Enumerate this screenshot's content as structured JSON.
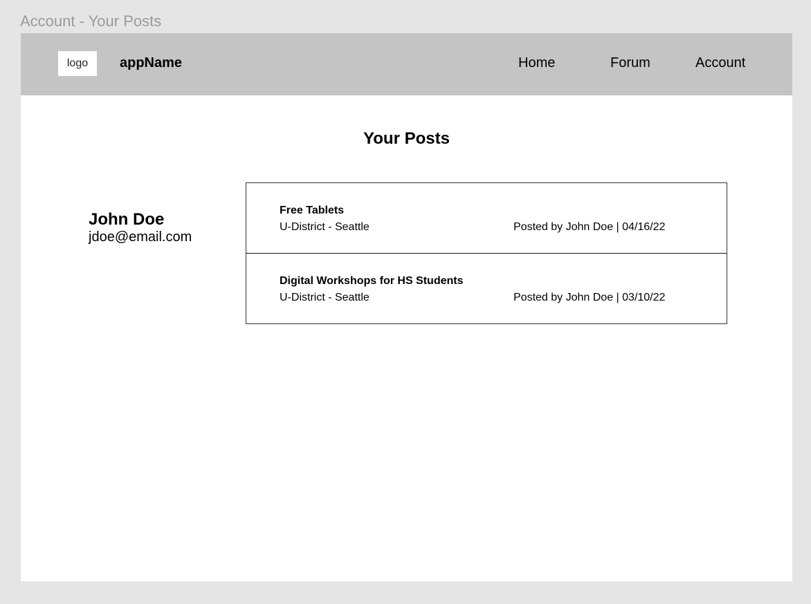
{
  "frame_label": "Account - Your Posts",
  "navbar": {
    "logo_text": "logo",
    "app_name": "appName",
    "links": [
      "Home",
      "Forum",
      "Account"
    ]
  },
  "page_title": "Your Posts",
  "user": {
    "name": "John Doe",
    "email": "jdoe@email.com"
  },
  "posts": [
    {
      "title": "Free Tablets",
      "location": "U-District - Seattle",
      "meta": "Posted by John Doe | 04/16/22"
    },
    {
      "title": "Digital Workshops for HS Students",
      "location": "U-District - Seattle",
      "meta": "Posted by John Doe | 03/10/22"
    }
  ],
  "colors": {
    "canvas_bg": "#e5e5e5",
    "navbar_bg": "#c4c4c4",
    "frame_bg": "#ffffff",
    "label_text": "#9a9a9a"
  }
}
